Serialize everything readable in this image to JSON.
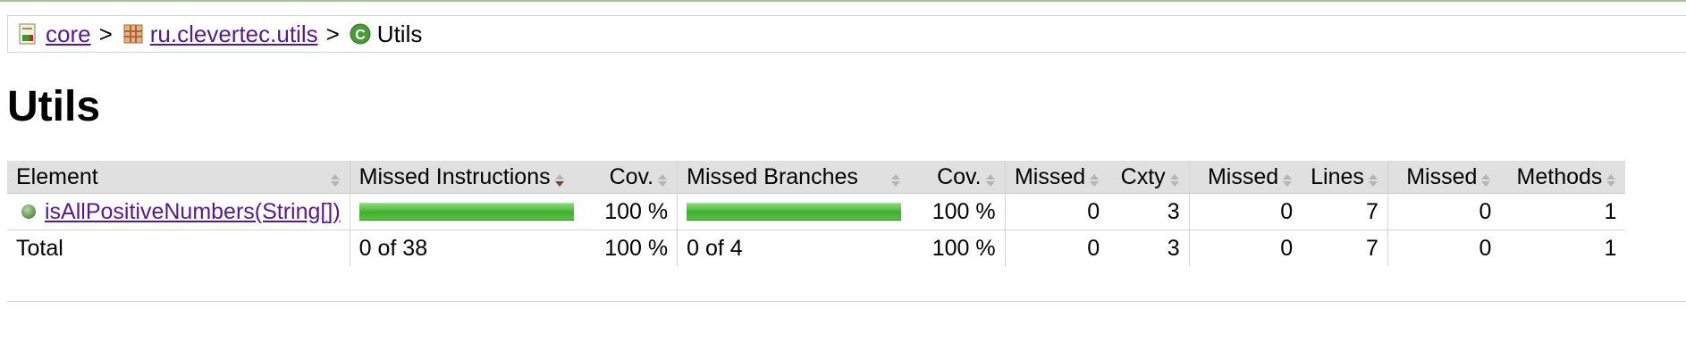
{
  "breadcrumb": {
    "items": [
      {
        "label": "core",
        "icon": "report-icon"
      },
      {
        "label": "ru.clevertec.utils",
        "icon": "package-icon"
      },
      {
        "label": "Utils",
        "icon": "class-icon"
      }
    ],
    "separator": ">"
  },
  "title": "Utils",
  "table": {
    "headers": {
      "element": "Element",
      "missed_instructions": "Missed Instructions",
      "instr_cov": "Cov.",
      "missed_branches": "Missed Branches",
      "branch_cov": "Cov.",
      "cxty_missed": "Missed",
      "cxty": "Cxty",
      "lines_missed": "Missed",
      "lines": "Lines",
      "methods_missed": "Missed",
      "methods": "Methods"
    },
    "rows": [
      {
        "element": "isAllPositiveNumbers(String[])",
        "instr_coverage_fraction": 1.0,
        "instr_cov": "100 %",
        "branch_coverage_fraction": 1.0,
        "branch_cov": "100 %",
        "cxty_missed": "0",
        "cxty": "3",
        "lines_missed": "0",
        "lines": "7",
        "methods_missed": "0",
        "methods": "1"
      }
    ],
    "total": {
      "label": "Total",
      "missed_instructions": "0 of 38",
      "instr_cov": "100 %",
      "missed_branches": "0 of 4",
      "branch_cov": "100 %",
      "cxty_missed": "0",
      "cxty": "3",
      "lines_missed": "0",
      "lines": "7",
      "methods_missed": "0",
      "methods": "1"
    }
  },
  "colors": {
    "link": "#551a8b",
    "header_bg": "#e0e0e0",
    "bar_green": "#3fae2f"
  }
}
